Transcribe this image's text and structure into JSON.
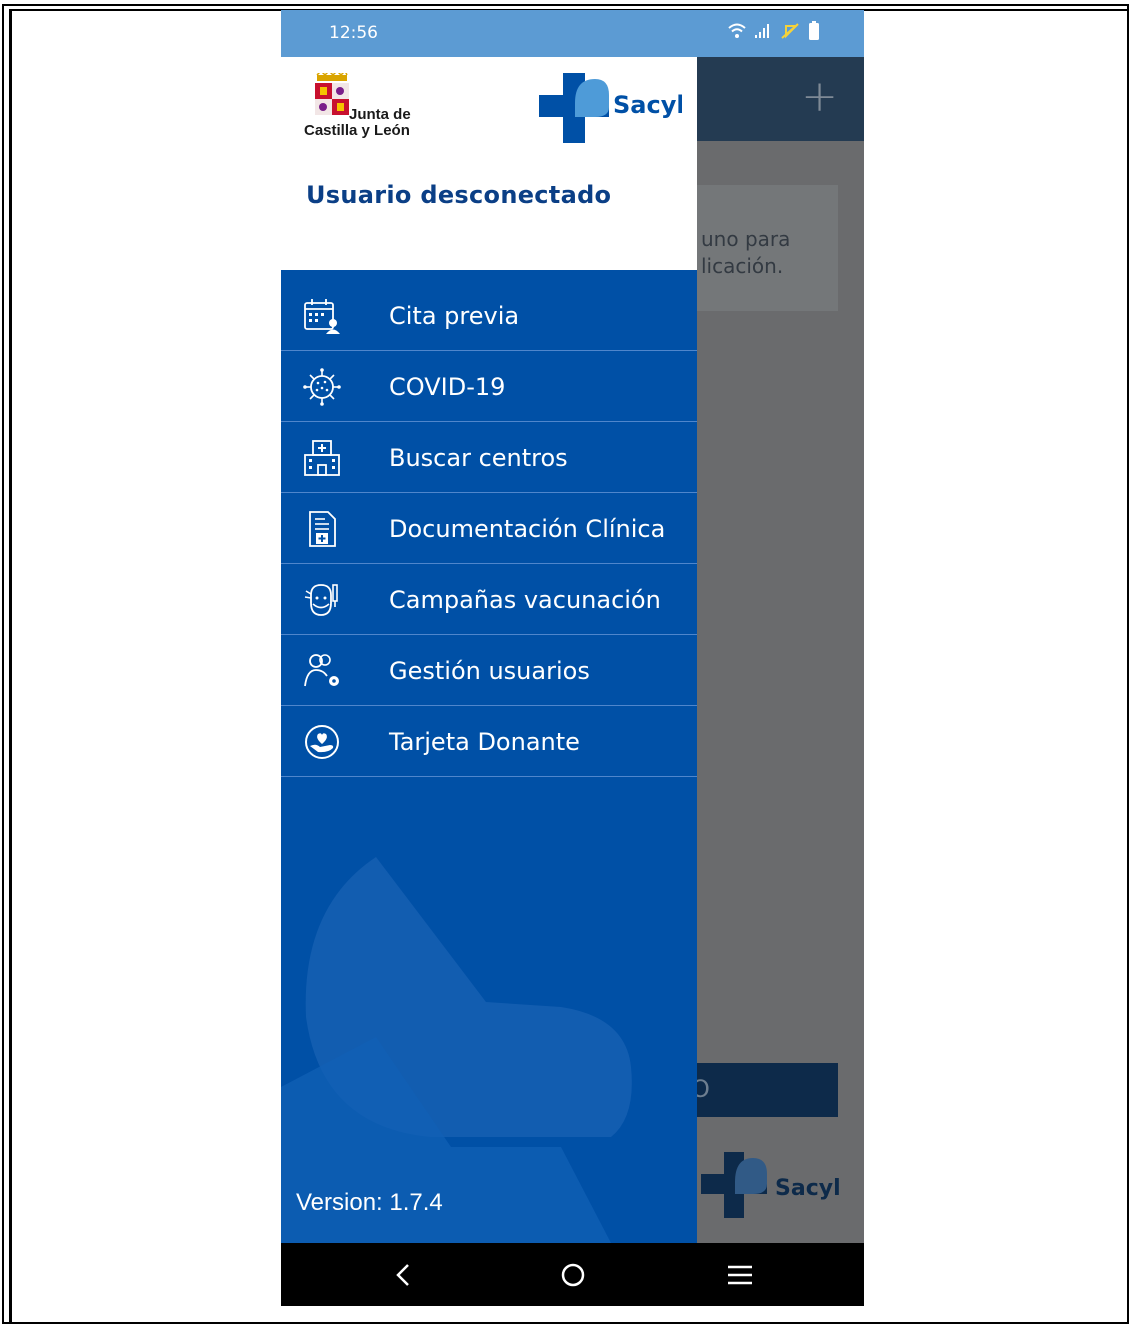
{
  "status_bar": {
    "time": "12:56"
  },
  "background_app": {
    "card_text": "uno para\nlicación.",
    "button_text": "O",
    "logo_text": "Sacyl"
  },
  "drawer": {
    "logo_left_text_line1": "Junta de",
    "logo_left_text_line2": "Castilla y León",
    "logo_right_text": "Sacyl",
    "user_status": "Usuario desconectado",
    "menu": [
      {
        "label": "Cita previa",
        "icon": "calendar-user-icon"
      },
      {
        "label": "COVID-19",
        "icon": "virus-icon"
      },
      {
        "label": "Buscar centros",
        "icon": "hospital-icon"
      },
      {
        "label": "Documentación Clínica",
        "icon": "medical-document-icon"
      },
      {
        "label": "Campañas vacunación",
        "icon": "vaccination-face-icon"
      },
      {
        "label": "Gestión usuarios",
        "icon": "users-settings-icon"
      },
      {
        "label": "Tarjeta Donante",
        "icon": "donor-heart-icon"
      }
    ],
    "version": "Version: 1.7.4"
  },
  "colors": {
    "drawer_bg": "#0050a6",
    "status_bar": "#5c9bd3",
    "brand_dark_blue": "#0b3f86"
  }
}
